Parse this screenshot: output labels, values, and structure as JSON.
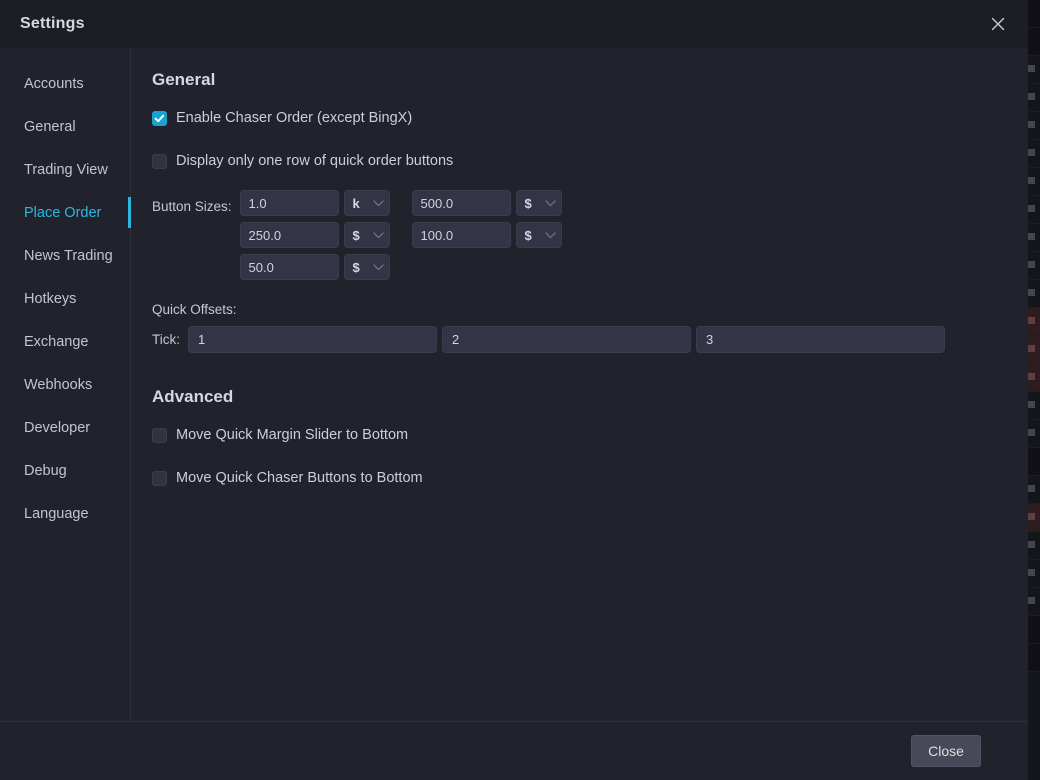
{
  "window": {
    "title": "Settings",
    "close_icon": "close-x-icon"
  },
  "sidebar": {
    "items": [
      {
        "label": "Accounts",
        "active": false
      },
      {
        "label": "General",
        "active": false
      },
      {
        "label": "Trading View",
        "active": false
      },
      {
        "label": "Place Order",
        "active": true
      },
      {
        "label": "News Trading",
        "active": false
      },
      {
        "label": "Hotkeys",
        "active": false
      },
      {
        "label": "Exchange",
        "active": false
      },
      {
        "label": "Webhooks",
        "active": false
      },
      {
        "label": "Developer",
        "active": false
      },
      {
        "label": "Debug",
        "active": false
      },
      {
        "label": "Language",
        "active": false
      }
    ],
    "active_color": "#2ab8e0"
  },
  "general": {
    "heading": "General",
    "checkboxes": [
      {
        "label": "Enable Chaser Order (except BingX)",
        "checked": true
      },
      {
        "label": "Display only one row of quick order buttons",
        "checked": false
      }
    ],
    "button_sizes": {
      "label": "Button Sizes:",
      "rows": [
        [
          {
            "value": "1.0",
            "unit": "k"
          },
          {
            "value": "500.0",
            "unit": "$"
          }
        ],
        [
          {
            "value": "250.0",
            "unit": "$"
          },
          {
            "value": "100.0",
            "unit": "$"
          }
        ],
        [
          {
            "value": "50.0",
            "unit": "$"
          }
        ]
      ]
    },
    "quick_offsets": {
      "label": "Quick Offsets:",
      "tick_label": "Tick:",
      "ticks": [
        "1",
        "2",
        "3"
      ]
    }
  },
  "advanced": {
    "heading": "Advanced",
    "checkboxes": [
      {
        "label": "Move Quick Margin Slider to Bottom",
        "checked": false
      },
      {
        "label": "Move Quick Chaser Buttons to Bottom",
        "checked": false
      }
    ]
  },
  "footer": {
    "close_label": "Close"
  },
  "colors": {
    "accent": "#2ab8e0",
    "checkbox_on": "#1ba2cf",
    "window_bg": "#22222c",
    "titlebar_bg": "#1d1d26",
    "field_bg": "#343446"
  }
}
